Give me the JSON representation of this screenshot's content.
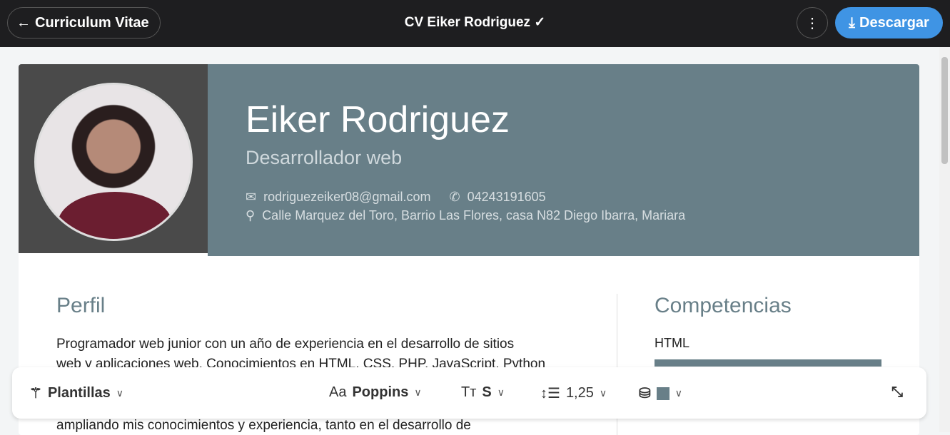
{
  "topbar": {
    "back_label": "Curriculum Vitae",
    "title": "CV Eiker Rodriguez",
    "download_label": "Descargar"
  },
  "cv": {
    "name": "Eiker Rodriguez",
    "role": "Desarrollador web",
    "email": "rodriguezeiker08@gmail.com",
    "phone": "04243191605",
    "address": "Calle Marquez del Toro, Barrio Las Flores, casa N82 Diego Ibarra, Mariara",
    "profile_title": "Perfil",
    "profile_lines": [
      "Programador web junior con un año de experiencia en el desarrollo de sitios",
      "web y aplicaciones web. Conocimientos en HTML, CSS, PHP, JavaScript, Python",
      "",
      "ampliando mis conocimientos y experiencia, tanto en el desarrollo de"
    ],
    "skills_title": "Competencias",
    "skills": [
      {
        "name": "HTML",
        "level": 1.0
      }
    ]
  },
  "toolbar": {
    "templates": "Plantillas",
    "font": "Poppins",
    "size": "S",
    "line_height": "1,25",
    "color": "#687f88"
  }
}
